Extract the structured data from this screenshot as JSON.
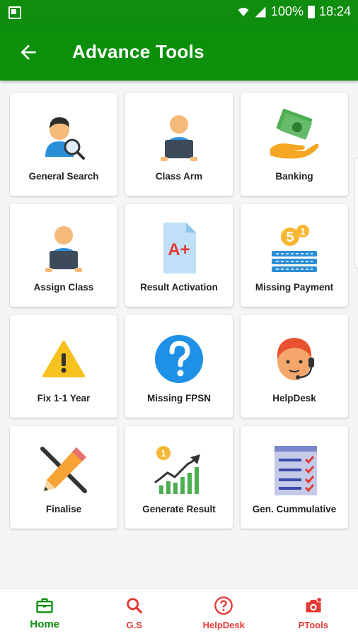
{
  "status_bar": {
    "battery": "100%",
    "time": "18:24"
  },
  "app_bar": {
    "title": "Advance Tools"
  },
  "colors": {
    "primary": "#0c900c",
    "nav_inactive": "#e53935",
    "text": "#222222"
  },
  "tools": [
    {
      "label": "General Search",
      "icon": "person-search-icon"
    },
    {
      "label": "Class Arm",
      "icon": "person-laptop-icon"
    },
    {
      "label": "Banking",
      "icon": "money-hand-icon"
    },
    {
      "label": "Assign Class",
      "icon": "person-laptop-icon"
    },
    {
      "label": "Result Activation",
      "icon": "grade-document-icon"
    },
    {
      "label": "Missing Payment",
      "icon": "coins-icon"
    },
    {
      "label": "Fix 1-1 Year",
      "icon": "warning-icon"
    },
    {
      "label": "Missing FPSN",
      "icon": "question-icon"
    },
    {
      "label": "HelpDesk",
      "icon": "headset-agent-icon"
    },
    {
      "label": "Finalise",
      "icon": "pencil-icon"
    },
    {
      "label": "Generate Result",
      "icon": "growth-chart-icon"
    },
    {
      "label": "Gen. Cummulative",
      "icon": "checklist-icon"
    }
  ],
  "grade_text": "A+",
  "coin_values": [
    "5",
    "1"
  ],
  "chart_coin_value": "1",
  "bottom_nav": [
    {
      "label": "Home",
      "icon": "briefcase-icon",
      "active": true
    },
    {
      "label": "G.S",
      "icon": "search-icon",
      "active": false
    },
    {
      "label": "HelpDesk",
      "icon": "help-circle-icon",
      "active": false
    },
    {
      "label": "PTools",
      "icon": "camera-icon",
      "active": false
    }
  ]
}
